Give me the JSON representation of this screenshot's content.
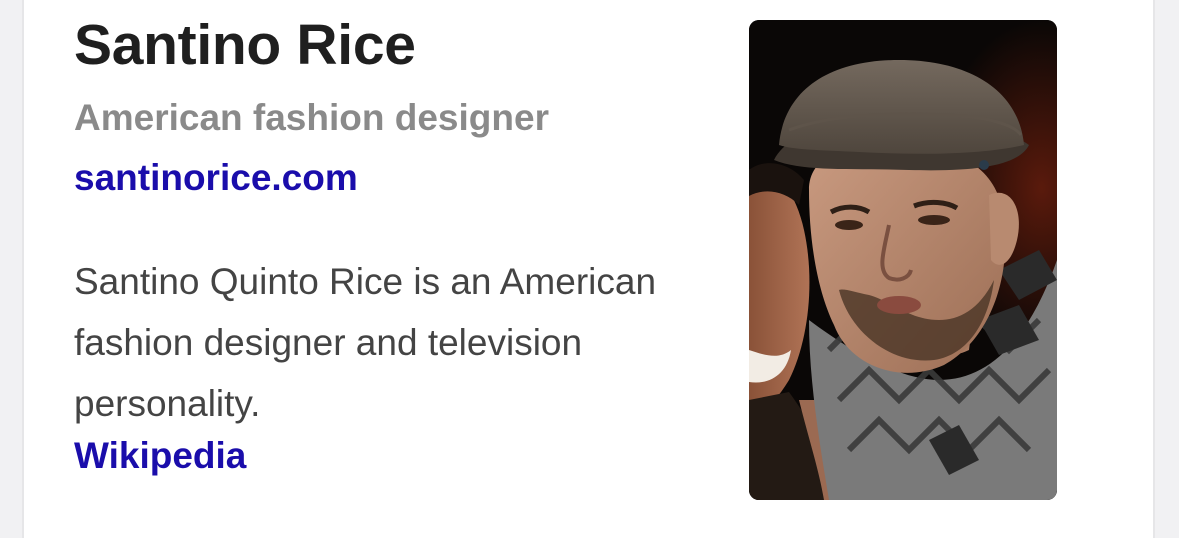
{
  "knowledge_panel": {
    "title": "Santino Rice",
    "subtitle": "American fashion designer",
    "website": "santinorice.com",
    "description": "Santino Quinto Rice is an American fashion designer and television personality.",
    "source_link": "Wikipedia",
    "colors": {
      "title": "#1f1f1f",
      "subtitle": "#8a8a8a",
      "link": "#1a0dab",
      "body_text": "#444444",
      "card_background": "#ffffff",
      "page_background": "#f1f1f3"
    }
  }
}
